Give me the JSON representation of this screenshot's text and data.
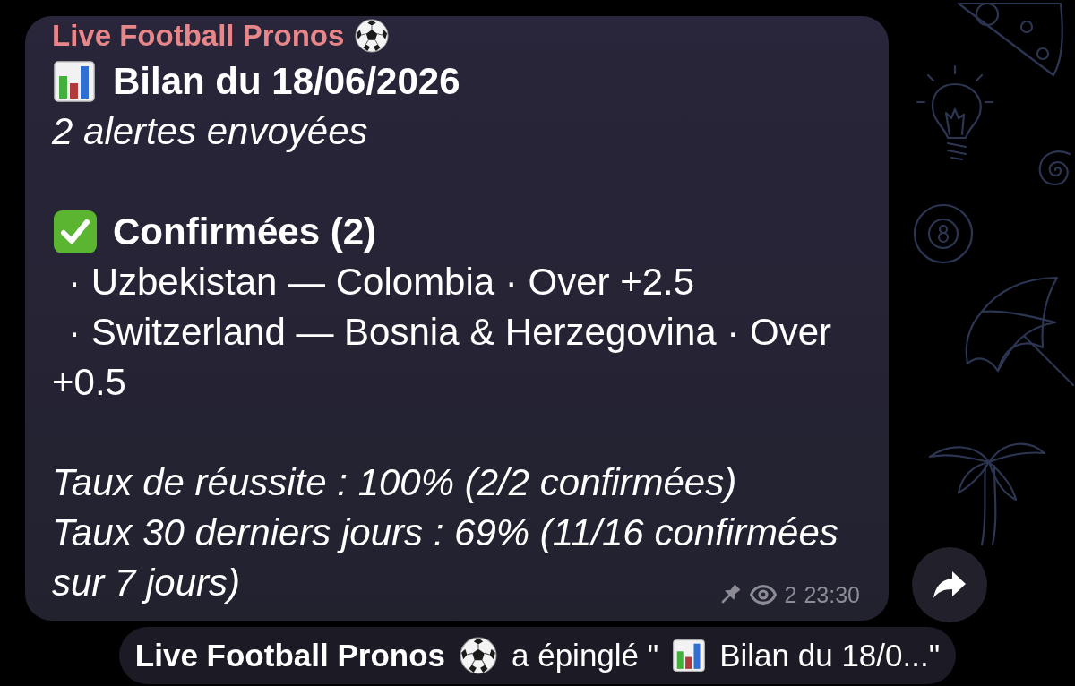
{
  "message": {
    "sender": "Live Football Pronos",
    "paragraphs": [
      [
        {
          "kind": "report_title",
          "text": "Bilan du 18/06/2026"
        },
        {
          "kind": "italic",
          "text": "2 alertes envoyées"
        }
      ],
      [
        {
          "kind": "confirmed_header",
          "text": "Confirmées (2)"
        },
        {
          "kind": "bullet",
          "text": "· Uzbekistan — Colombia · Over +2.5"
        },
        {
          "kind": "bullet",
          "text": "· Switzerland — Bosnia & Herzegovina · Over +0.5"
        }
      ],
      [
        {
          "kind": "italic",
          "text": "Taux de réussite : 100% (2/2 confirmées)"
        },
        {
          "kind": "italic",
          "text": "Taux 30 derniers jours : 69% (11/16 confirmées"
        },
        {
          "kind": "italic",
          "text": "sur 7 jours)"
        }
      ]
    ],
    "pinned": true,
    "views": "2",
    "time": "23:30"
  },
  "service_message": {
    "actor": "Live Football Pronos",
    "action": "a épinglé \"",
    "quote": "Bilan du 18/0...\""
  }
}
